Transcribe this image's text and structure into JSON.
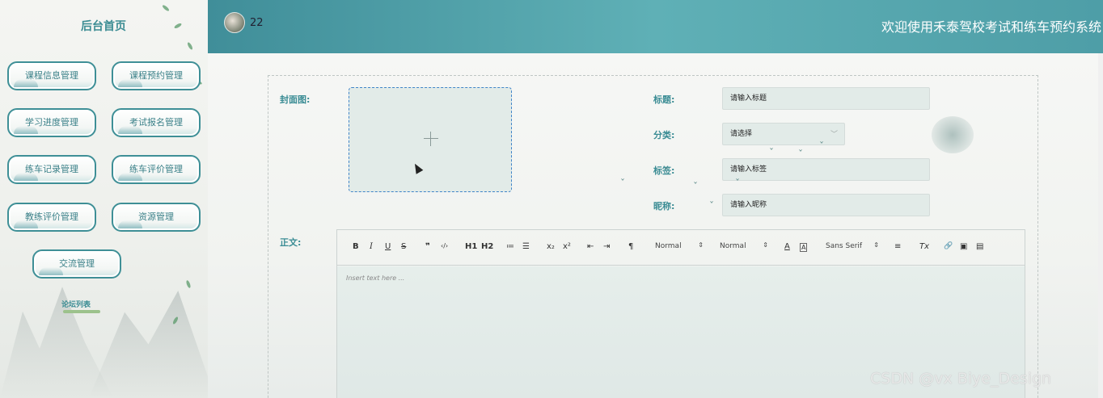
{
  "sidebar": {
    "home": "后台首页",
    "menu": [
      "课程信息管理",
      "课程预约管理",
      "学习进度管理",
      "考试报名管理",
      "练车记录管理",
      "练车评价管理",
      "教练评价管理",
      "资源管理",
      "交流管理"
    ],
    "forum": "论坛列表"
  },
  "header": {
    "username": "22",
    "welcome": "欢迎使用禾泰驾校考试和练车预约系统"
  },
  "form": {
    "cover_label": "封面图:",
    "title_label": "标题:",
    "title_placeholder": "请输入标题",
    "category_label": "分类:",
    "category_value": "请选择",
    "tag_label": "标签:",
    "tag_placeholder": "请输入标签",
    "nickname_label": "昵称:",
    "nickname_placeholder": "请输入昵称",
    "body_label": "正文:"
  },
  "editor": {
    "toolbar": {
      "bold": "B",
      "italic": "I",
      "underline": "U",
      "strike": "S",
      "quote": "❞",
      "code": "‹/›",
      "h1": "H1",
      "h2": "H2",
      "ordered": "≔",
      "bullet": "☰",
      "sub": "x₂",
      "sup": "x²",
      "outdent": "⇤",
      "indent": "⇥",
      "direction": "¶",
      "size": "Normal",
      "header": "Normal",
      "color": "A",
      "background": "A",
      "font": "Sans Serif",
      "align": "≡",
      "clean": "Tx",
      "link": "🔗",
      "image": "▣",
      "video": "▤"
    },
    "placeholder": "Insert text here ..."
  },
  "watermark": "CSDN @vx  Biye_Design",
  "colors": {
    "header": "#4a9ea6",
    "accent": "#3a8c94",
    "upload_border": "#3f84c8"
  }
}
